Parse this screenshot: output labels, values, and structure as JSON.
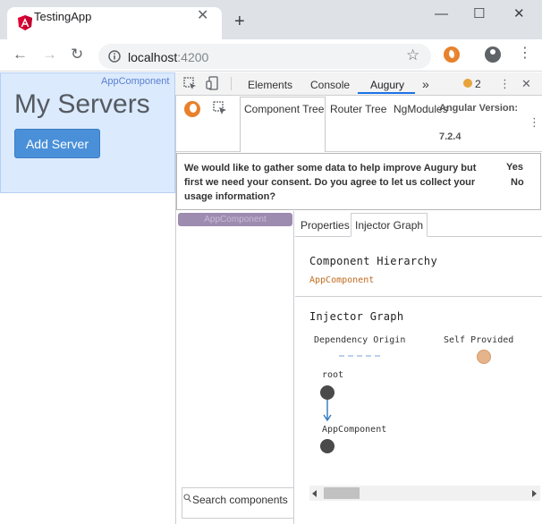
{
  "browser": {
    "tab_title": "TestingApp",
    "tab_close": "✕",
    "new_tab": "+",
    "window_minimize": "—",
    "window_maximize": "☐",
    "window_close": "✕",
    "back": "←",
    "forward": "→",
    "reload": "↻",
    "url_host": "localhost",
    "url_port": ":4200",
    "star": "☆",
    "menu": "⋮"
  },
  "app": {
    "component_label": "AppComponent",
    "heading": "My Servers",
    "add_server_label": "Add Server"
  },
  "devtools": {
    "tabs": [
      {
        "label": "Elements"
      },
      {
        "label": "Console"
      },
      {
        "label": "Augury"
      },
      {
        "label": "»"
      }
    ],
    "warning_count": "2",
    "menu": "⋮",
    "close": "✕",
    "inspect_icon": "⬚",
    "device_icon": "▯"
  },
  "augury": {
    "tabs": [
      {
        "label": "Component Tree"
      },
      {
        "label": "Router Tree"
      },
      {
        "label": "NgModules"
      }
    ],
    "angular_version_label": "Angular Version:",
    "angular_version": "7.2.4",
    "menu": "⋮",
    "consent": {
      "message": "We would like to gather some data to help improve Augury but first we need your consent. Do you agree to let us collect your usage information?",
      "yes": "Yes",
      "no": "No"
    },
    "tree_node": "AppComponent",
    "search_placeholder": "Search components",
    "detail_tabs": [
      {
        "label": "Properties"
      },
      {
        "label": "Injector Graph"
      }
    ],
    "component_hierarchy_title": "Component Hierarchy",
    "hierarchy_item": "AppComponent",
    "injector_graph_title": "Injector Graph",
    "legend_dependency": "Dependency Origin",
    "legend_self": "Self Provided",
    "graph_nodes": [
      {
        "label": "root"
      },
      {
        "label": "AppComponent"
      }
    ]
  },
  "colors": {
    "app_background": "#dbeafd",
    "button_blue": "#4a90d9",
    "augury_orange": "#e8812c",
    "active_tab_underline": "#1a73e8"
  }
}
